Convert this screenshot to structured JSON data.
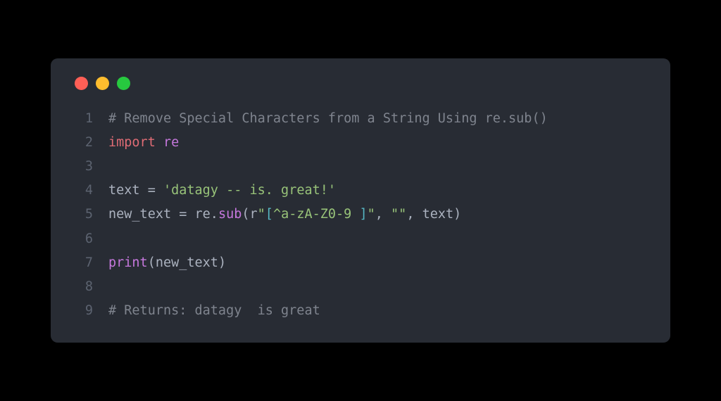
{
  "window": {
    "controls": {
      "close": "close",
      "minimize": "minimize",
      "maximize": "maximize"
    }
  },
  "code": {
    "lines": [
      {
        "num": "1"
      },
      {
        "num": "2"
      },
      {
        "num": "3"
      },
      {
        "num": "4"
      },
      {
        "num": "5"
      },
      {
        "num": "6"
      },
      {
        "num": "7"
      },
      {
        "num": "8"
      },
      {
        "num": "9"
      }
    ],
    "line1_comment": "# Remove Special Characters from a String Using re.sub()",
    "line2_import": "import",
    "line2_module": " re",
    "line4_var": "text",
    "line4_eq": " = ",
    "line4_str": "'datagy -- is. great!'",
    "line5_var": "new_text",
    "line5_eq": " = ",
    "line5_obj": "re.",
    "line5_func": "sub",
    "line5_lp": "(",
    "line5_prefix": "r",
    "line5_q1": "\"",
    "line5_br1": "[",
    "line5_regex": "^a-zA-Z0-9 ",
    "line5_br2": "]",
    "line5_q2": "\"",
    "line5_comma1": ", ",
    "line5_empty": "\"\"",
    "line5_comma2": ", text",
    "line5_rp": ")",
    "line7_func": "print",
    "line7_lp": "(",
    "line7_arg": "new_text",
    "line7_rp": ")",
    "line9_comment": "# Returns: datagy  is great"
  }
}
